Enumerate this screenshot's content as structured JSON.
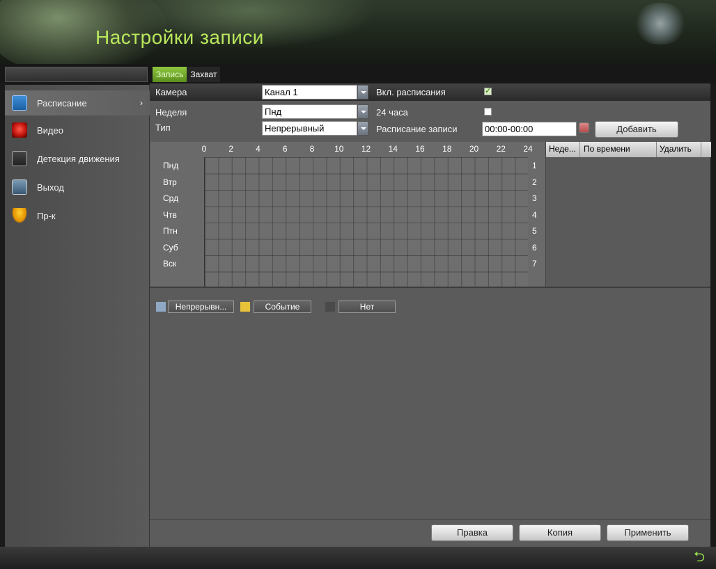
{
  "window": {
    "title": "Настройки записи"
  },
  "sidebar": {
    "items": [
      {
        "label": "Расписание",
        "icon": "calendar-icon",
        "active": true
      },
      {
        "label": "Видео",
        "icon": "video-record-icon"
      },
      {
        "label": "Детекция движения",
        "icon": "motion-detection-icon"
      },
      {
        "label": "Выход",
        "icon": "output-icon"
      },
      {
        "label": "Пр-к",
        "icon": "advanced-icon"
      }
    ],
    "arrow": "›"
  },
  "tabs": [
    {
      "label": "Запись",
      "active": true
    },
    {
      "label": "Захват",
      "active": false
    }
  ],
  "form": {
    "camera_label": "Камера",
    "camera_value": "Канал 1",
    "enable_schedule_label": "Вкл. расписания",
    "enable_schedule_checked": true,
    "week_label": "Неделя",
    "week_value": "Пнд",
    "allday_label": "24 часа",
    "allday_checked": false,
    "type_label": "Тип",
    "type_value": "Непрерывный",
    "schedule_label": "Расписание записи",
    "schedule_value": "00:00-00:00",
    "add_button": "Добавить"
  },
  "grid": {
    "hours": [
      "0",
      "2",
      "4",
      "6",
      "8",
      "10",
      "12",
      "14",
      "16",
      "18",
      "20",
      "22",
      "24"
    ],
    "days": [
      "Пнд",
      "Втр",
      "Срд",
      "Чтв",
      "Птн",
      "Суб",
      "Вск"
    ],
    "row_numbers": [
      "1",
      "2",
      "3",
      "4",
      "5",
      "6",
      "7"
    ]
  },
  "period_list": {
    "columns": [
      "Неде...",
      "По времени",
      "Удалить"
    ]
  },
  "legend": [
    {
      "label": "Непрерывн...",
      "color": "#8fa9c4"
    },
    {
      "label": "Событие",
      "color": "#e8c33a"
    },
    {
      "label": "Нет",
      "color": "#4a4a4a"
    }
  ],
  "footer": {
    "edit_button": "Правка",
    "copy_button": "Копия",
    "apply_button": "Применить"
  },
  "colors": {
    "title": "#b9e85c",
    "tab_active": "#8ec63f"
  }
}
